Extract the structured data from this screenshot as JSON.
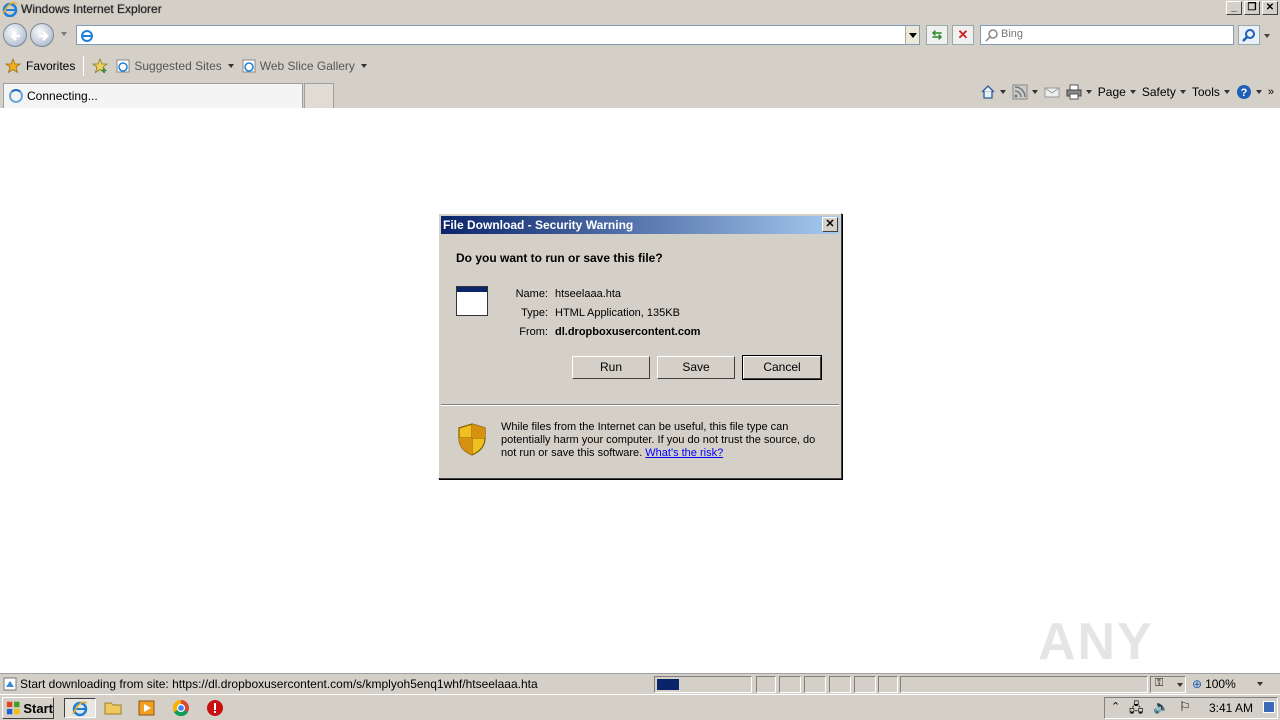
{
  "window": {
    "title": "Windows Internet Explorer",
    "minimize": "_",
    "restore": "❐",
    "close": "✕"
  },
  "address_bar": {
    "url": "",
    "search_placeholder": "Bing"
  },
  "favorites_bar": {
    "favorites_label": "Favorites",
    "items": [
      {
        "label": "Suggested Sites"
      },
      {
        "label": "Web Slice Gallery"
      }
    ]
  },
  "tab": {
    "label": "Connecting..."
  },
  "command_bar": {
    "page_label": "Page",
    "safety_label": "Safety",
    "tools_label": "Tools"
  },
  "dialog": {
    "title": "File Download - Security Warning",
    "close_glyph": "✕",
    "question": "Do you want to run or save this file?",
    "name_label": "Name:",
    "name_value": "htseelaaa.hta",
    "type_label": "Type:",
    "type_value": "HTML Application, 135KB",
    "from_label": "From:",
    "from_value": "dl.dropboxusercontent.com",
    "run_button": "Run",
    "save_button": "Save",
    "cancel_button": "Cancel",
    "warning_text": "While files from the Internet can be useful, this file type can potentially harm your computer. If you do not trust the source, do not run or save this software.",
    "risk_link": "What's the risk?"
  },
  "status_bar": {
    "text": "Start downloading from site: https://dl.dropboxusercontent.com/s/kmplyoh5enq1whf/htseelaaa.hta",
    "zoom": "100%"
  },
  "watermark": "ANY RUN",
  "taskbar": {
    "start_label": "Start",
    "clock": "3:41 AM"
  },
  "colors": {
    "dialog_title_start": "#0a246a",
    "dialog_title_end": "#a6caf0",
    "chrome": "#d4d0c8",
    "link": "#0000ff"
  }
}
